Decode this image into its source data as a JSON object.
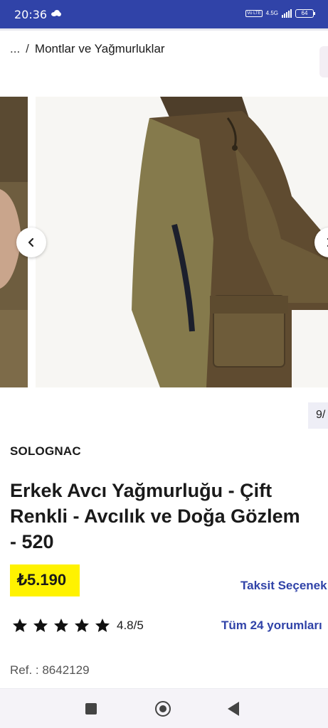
{
  "status_bar": {
    "time": "20:36",
    "network_label": "4.5G",
    "volte_label": "Vo LTE",
    "battery": "64"
  },
  "breadcrumb": {
    "ellipsis": "...",
    "separator": "/",
    "current": "Montlar ve Yağmurluklar"
  },
  "gallery": {
    "prev_icon": "chevron-left-icon",
    "next_icon": "chevron-right-icon",
    "counter": "9/"
  },
  "product": {
    "brand": "SOLOGNAC",
    "title": "Erkek Avcı Yağmurluğu - Çift\nRenkli - Avcılık ve Doğa Gözlem\n- 520",
    "price": "₺5.190",
    "installments_link": "Taksit Seçenek",
    "rating_value": 4.8,
    "rating_text": "4.8/5",
    "stars_count": 5,
    "reviews_link": "Tüm 24 yorumları",
    "ref": "Ref. : 8642129"
  },
  "colors": {
    "status_bar": "#3043a8",
    "link": "#3043a8",
    "price_bg": "#fff200",
    "jacket_dark": "#5e4a30",
    "jacket_light": "#857a4c"
  }
}
